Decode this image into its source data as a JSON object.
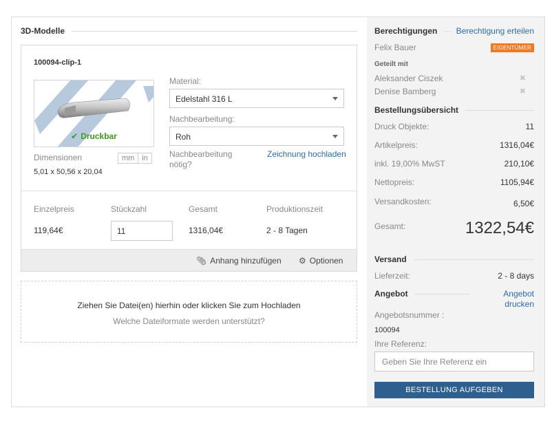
{
  "models_section": {
    "title": "3D-Modelle"
  },
  "model": {
    "name": "100094-clip-1",
    "printable_label": "Druckbar",
    "dimensions_label": "Dimensionen",
    "unit_mm": "mm",
    "unit_in": "in",
    "dimensions_value": "5,01 x 50,56 x 20,04",
    "material_label": "Material:",
    "material_value": "Edelstahl 316 L",
    "post_label": "Nachbearbeitung:",
    "post_value": "Roh",
    "post_needed_label_1": "Nachbearbeitung",
    "post_needed_label_2": "nötig?",
    "upload_drawing_link": "Zeichnung hochladen",
    "columns": {
      "unit_price": "Einzelpreis",
      "quantity": "Stückzahl",
      "total": "Gesamt",
      "production_time": "Produktionszeit"
    },
    "values": {
      "unit_price": "119,64€",
      "quantity": "11",
      "total": "1316,04€",
      "production_time": "2 - 8 Tagen"
    },
    "add_attachment": "Anhang hinzufügen",
    "options": "Optionen"
  },
  "dropzone": {
    "main": "Ziehen Sie Datei(en) hierhin oder klicken Sie zum Hochladen",
    "sub": "Welche Dateiformate werden unterstützt?"
  },
  "permissions": {
    "title": "Berechtigungen",
    "grant_link": "Berechtigung erteilen",
    "owner_name": "Felix Bauer",
    "owner_badge": "EIGENTÜMER",
    "shared_with_label": "Geteilt mit",
    "shared_users": [
      "Aleksander Ciszek",
      "Denise Bamberg"
    ],
    "remove_glyph": "✖"
  },
  "order_summary": {
    "title": "Bestellungsübersicht",
    "rows": [
      {
        "label": "Druck Objekte:",
        "value": "11"
      },
      {
        "label": "Artikelpreis:",
        "value": "1316,04€"
      },
      {
        "label": "inkl. 19,00% MwST",
        "value": "210,10€"
      },
      {
        "label": "Nettopreis:",
        "value": "1105,94€"
      },
      {
        "label": "Versandkosten:",
        "value": "6,50€"
      }
    ],
    "grand_total_label": "Gesamt:",
    "grand_total_value": "1322,54€"
  },
  "shipping": {
    "title": "Versand",
    "delivery_label": "Lieferzeit:",
    "delivery_value": "2 - 8 days"
  },
  "offer": {
    "title": "Angebot",
    "print_link_1": "Angebot",
    "print_link_2": "drucken",
    "number_label": "Angebotsnummer :",
    "number_value": "100094",
    "reference_label": "Ihre Referenz:",
    "reference_placeholder": "Geben Sie Ihre Referenz ein"
  },
  "submit_button": "BESTELLUNG AUFGEBEN",
  "colors": {
    "accent_blue": "#2b6cb0",
    "submit_bg": "#2f5f8f",
    "owner_badge": "#f07a22",
    "printable_green": "#3a9b1c"
  }
}
